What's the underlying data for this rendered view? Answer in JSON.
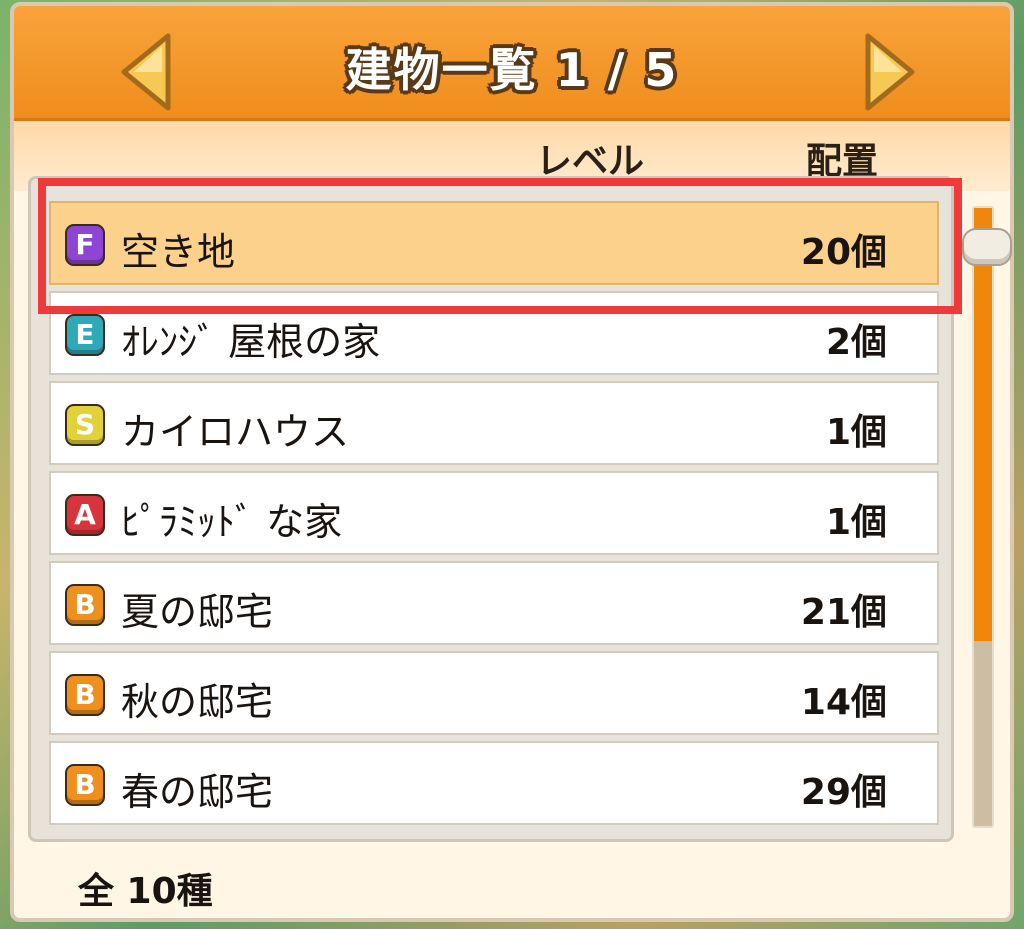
{
  "header": {
    "title": "建物一覧 1 / 5"
  },
  "columns": {
    "level": "レベル",
    "placement": "配置"
  },
  "rows": [
    {
      "rank": "F",
      "rank_color": "#8e44d4",
      "name": "空き地",
      "count": "20個"
    },
    {
      "rank": "E",
      "rank_color": "#2fa8b8",
      "name": "ｵﾚﾝｼﾞ 屋根の家",
      "count": "2個"
    },
    {
      "rank": "S",
      "rank_color": "#e2d23a",
      "name": "カイロハウス",
      "count": "1個"
    },
    {
      "rank": "A",
      "rank_color": "#d8343c",
      "name": "ﾋﾟﾗﾐｯﾄﾞ な家",
      "count": "1個"
    },
    {
      "rank": "B",
      "rank_color": "#ef8f1e",
      "name": "夏の邸宅",
      "count": "21個"
    },
    {
      "rank": "B",
      "rank_color": "#ef8f1e",
      "name": "秋の邸宅",
      "count": "14個"
    },
    {
      "rank": "B",
      "rank_color": "#ef8f1e",
      "name": "春の邸宅",
      "count": "29個"
    }
  ],
  "selected_index": 0,
  "scrollbar": {
    "position_fraction": 0.7
  },
  "footer": {
    "total": "全 10種"
  },
  "colors": {
    "header": "#f29528",
    "highlight": "#ee3a3a",
    "selected_row": "#fcd18c"
  }
}
